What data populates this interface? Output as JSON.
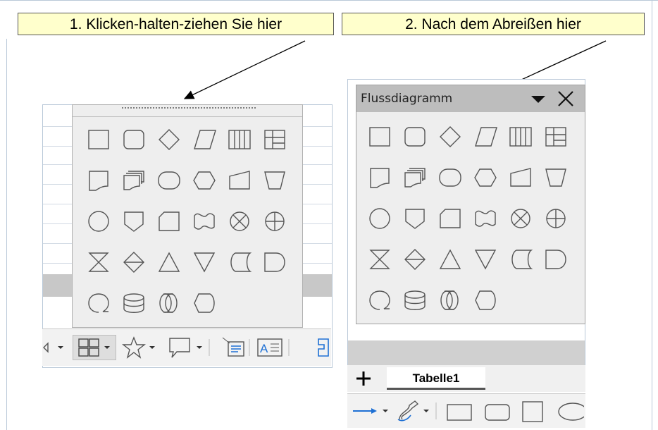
{
  "callouts": {
    "step1": "1. Klicken-halten-ziehen Sie hier",
    "step2": "2. Nach dem Abreißen hier"
  },
  "floating_toolbar": {
    "title": "Flussdiagramm",
    "menu_icon": "triangle-down-icon",
    "close_icon": "close-icon"
  },
  "flowchart_shapes": [
    "process-icon",
    "alternate-process-icon",
    "decision-icon",
    "data-icon",
    "predefined-process-icon",
    "internal-storage-icon",
    "document-icon",
    "multidocument-icon",
    "terminator-icon",
    "preparation-icon",
    "manual-input-icon",
    "manual-operation-icon",
    "connector-icon",
    "off-page-connector-icon",
    "card-icon",
    "punched-tape-icon",
    "summing-junction-icon",
    "or-icon",
    "collate-icon",
    "sort-icon",
    "extract-icon",
    "merge-icon",
    "stored-data-icon",
    "delay-icon",
    "sequential-access-icon",
    "magnetic-disc-icon",
    "direct-access-storage-icon",
    "display-icon"
  ],
  "sheet_tabs": {
    "add_icon": "plus-icon",
    "active_tab": "Tabelle1"
  },
  "left_toolbar_icons": [
    "arrow-dropdown-icon",
    "flowchart-dropdown-icon",
    "stars-dropdown-icon",
    "callout-dropdown-icon",
    "text-box-vertical-icon",
    "fontwork-icon",
    "frame-icon"
  ],
  "right_toolbar_icons": [
    "line-arrow-icon",
    "curve-icon",
    "rectangle-icon",
    "rounded-rectangle-icon",
    "square-icon",
    "ellipse-icon"
  ],
  "colors": {
    "callout_bg": "#ffffcc",
    "panel_bg": "#eeeeee",
    "titlebar_bg": "#bdbdbd",
    "accent_blue": "#1e70d4"
  }
}
